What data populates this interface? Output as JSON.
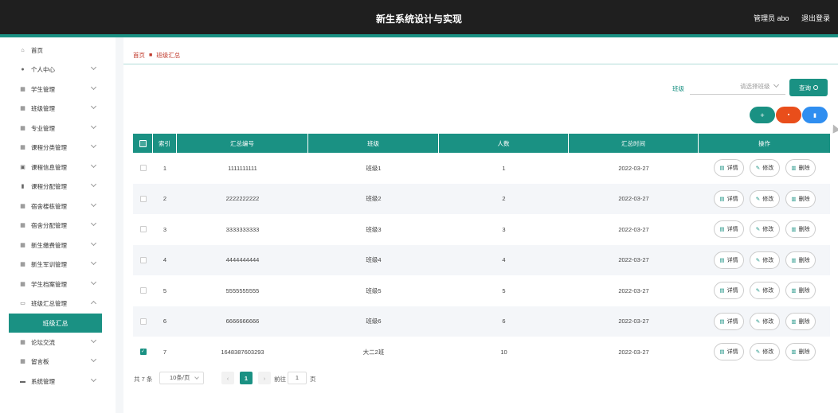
{
  "header": {
    "title": "新生系统设计与实现",
    "user_role": "管理员 abo",
    "logout_label": "退出登录"
  },
  "sidebar": {
    "items": [
      {
        "label": "首页",
        "icon": "home-icon"
      },
      {
        "label": "个人中心",
        "icon": "user-icon"
      },
      {
        "label": "学生管理",
        "icon": "grid-icon"
      },
      {
        "label": "班级管理",
        "icon": "grid-icon"
      },
      {
        "label": "专业管理",
        "icon": "grid-icon"
      },
      {
        "label": "课程分类管理",
        "icon": "grid-icon"
      },
      {
        "label": "课程信息管理",
        "icon": "briefcase-icon"
      },
      {
        "label": "课程分配管理",
        "icon": "bar-chart-icon"
      },
      {
        "label": "宿舍楼栋管理",
        "icon": "grid-icon"
      },
      {
        "label": "宿舍分配管理",
        "icon": "grid-icon"
      },
      {
        "label": "新生缴费管理",
        "icon": "grid-icon"
      },
      {
        "label": "新生军训管理",
        "icon": "grid-icon"
      },
      {
        "label": "学生档案管理",
        "icon": "grid-icon"
      },
      {
        "label": "班级汇总管理",
        "icon": "monitor-icon"
      },
      {
        "label": "论坛交流",
        "icon": "grid-icon"
      },
      {
        "label": "留言板",
        "icon": "grid-icon"
      },
      {
        "label": "系统管理",
        "icon": "chat-icon"
      }
    ],
    "active_sub": "班级汇总"
  },
  "breadcrumb": {
    "home": "首页",
    "current": "班级汇总"
  },
  "search": {
    "label": "班级",
    "placeholder": "请选择班级",
    "query_label": "查询"
  },
  "table": {
    "columns": [
      "索引",
      "汇总编号",
      "班级",
      "人数",
      "汇总时间",
      "操作"
    ],
    "action_labels": {
      "detail": "详情",
      "edit": "修改",
      "delete": "删除"
    },
    "rows": [
      {
        "index": "1",
        "code": "1111111111",
        "class": "班级1",
        "count": "1",
        "time": "2022-03-27",
        "checked": false
      },
      {
        "index": "2",
        "code": "2222222222",
        "class": "班级2",
        "count": "2",
        "time": "2022-03-27",
        "checked": false
      },
      {
        "index": "3",
        "code": "3333333333",
        "class": "班级3",
        "count": "3",
        "time": "2022-03-27",
        "checked": false
      },
      {
        "index": "4",
        "code": "4444444444",
        "class": "班级4",
        "count": "4",
        "time": "2022-03-27",
        "checked": false
      },
      {
        "index": "5",
        "code": "5555555555",
        "class": "班级5",
        "count": "5",
        "time": "2022-03-27",
        "checked": false
      },
      {
        "index": "6",
        "code": "6666666666",
        "class": "班级6",
        "count": "6",
        "time": "2022-03-27",
        "checked": false
      },
      {
        "index": "7",
        "code": "1648387603293",
        "class": "大二2班",
        "count": "10",
        "time": "2022-03-27",
        "checked": true
      }
    ]
  },
  "pagination": {
    "total": "共 7 条",
    "page_size": "10条/页",
    "current_page": "1",
    "goto_label": "前往",
    "goto_value": "1",
    "page_suffix": "页"
  },
  "colors": {
    "accent": "#1a9183",
    "danger": "#e94e1b",
    "info": "#2f8ef0",
    "header_bg": "#1f1f1f"
  }
}
